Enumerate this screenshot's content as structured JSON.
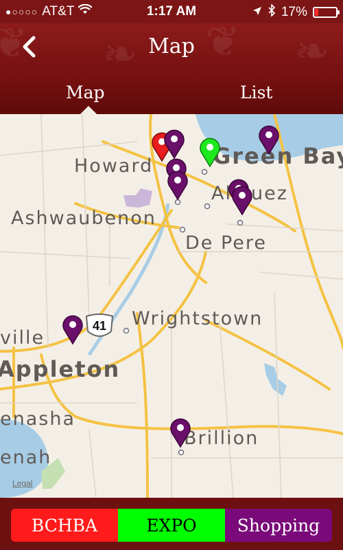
{
  "status_bar": {
    "signal": "●○○○○",
    "carrier": "AT&T",
    "time": "1:17 AM",
    "battery": "17%",
    "battery_level": 0.17,
    "battery_color": "#ff2b2b"
  },
  "nav": {
    "title": "Map",
    "back_icon": "chevron-left-icon"
  },
  "tabs": [
    {
      "label": "Map",
      "selected": true
    },
    {
      "label": "List",
      "selected": false
    }
  ],
  "map": {
    "labels": [
      "Green Bay",
      "Howard",
      "Allouez",
      "Ashwaubenon",
      "De Pere",
      "Wrightstown",
      "ville",
      "Appleton",
      "enasha",
      "Brillion",
      "enah"
    ],
    "highway_shield": "41",
    "legal": "Legal",
    "pin_colors": {
      "red": "#e81d1d",
      "green": "#1ee81e",
      "purple": "#6a0f6a"
    }
  },
  "footer": {
    "buttons": [
      {
        "label": "BCHBA",
        "color": "#ff1b1b"
      },
      {
        "label": "EXPO",
        "color": "#00ff00"
      },
      {
        "label": "Shopping",
        "color": "#7a0a7a"
      }
    ]
  }
}
